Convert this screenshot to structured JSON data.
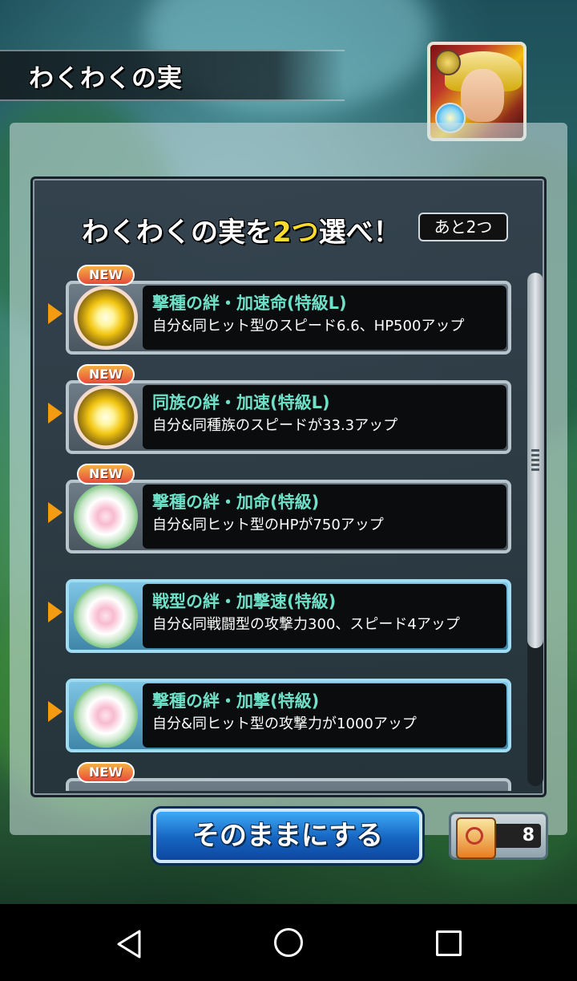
{
  "header": {
    "title": "わくわくの実"
  },
  "panel": {
    "heading_prefix": "わくわくの実を",
    "heading_count": "2つ",
    "heading_suffix": "選べ！",
    "remaining": "あと2つ"
  },
  "fruits": [
    {
      "badge": "NEW",
      "name": "撃種の絆・加速命(特級L)",
      "desc": "自分&同ヒット型のスピード6.6、HP500アップ",
      "icon": "gold-fruit-icon"
    },
    {
      "badge": "NEW",
      "name": "同族の絆・加速(特級L)",
      "desc": "自分&同種族のスピードが33.3アップ",
      "icon": "gold-fruit-icon"
    },
    {
      "badge": "NEW",
      "name": "撃種の絆・加命(特級)",
      "desc": "自分&同ヒット型のHPが750アップ",
      "icon": "white-fruit-icon"
    },
    {
      "badge": "",
      "name": "戦型の絆・加撃速(特級)",
      "desc": "自分&同戦闘型の攻撃力300、スピード4アップ",
      "icon": "white-fruit-icon"
    },
    {
      "badge": "",
      "name": "撃種の絆・加撃(特級)",
      "desc": "自分&同ヒット型の攻撃力が1000アップ",
      "icon": "white-fruit-icon"
    },
    {
      "badge": "NEW",
      "name": "",
      "desc": "",
      "icon": ""
    }
  ],
  "footer": {
    "keep_button": "そのままにする",
    "scroll_count": "8"
  },
  "colors": {
    "fruit_name": "#6fe0c8",
    "accent_yellow": "#f7dc2a",
    "button_blue": "#1565c0"
  }
}
